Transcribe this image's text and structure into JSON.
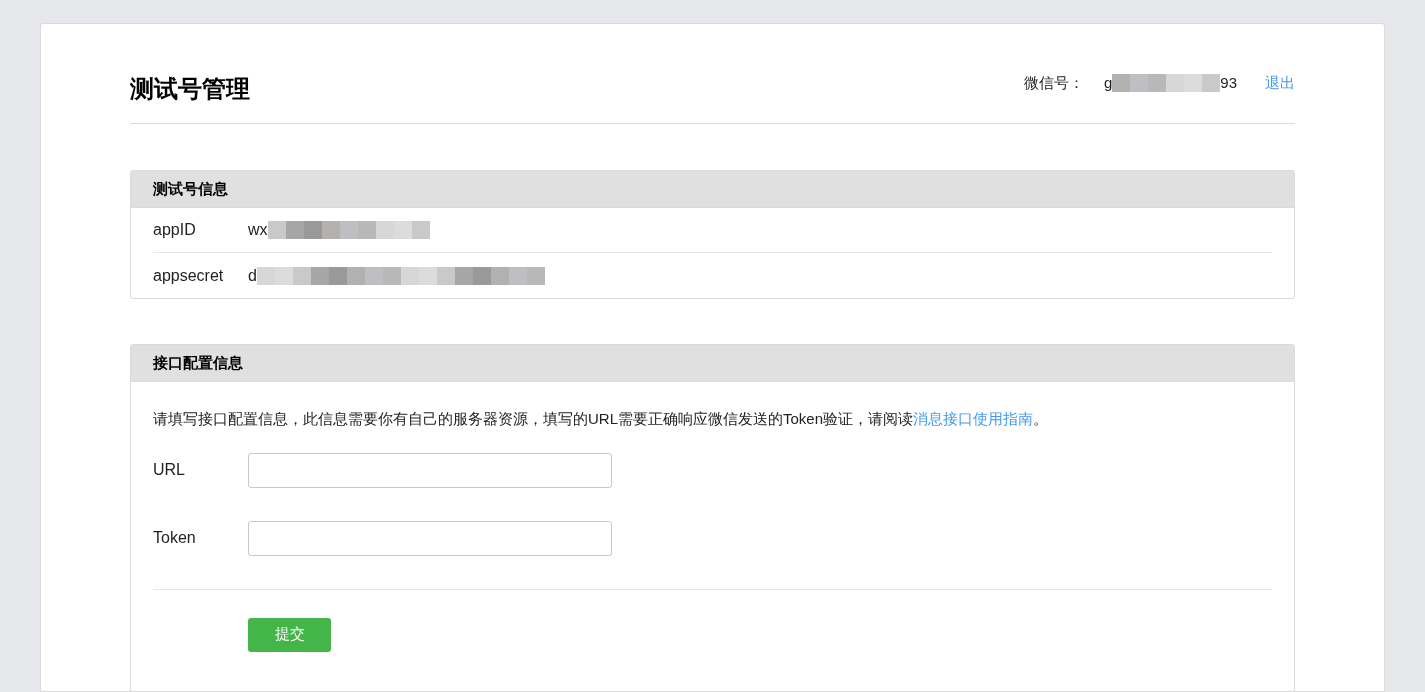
{
  "header": {
    "title": "测试号管理",
    "wechat_label": "微信号：",
    "wechat_id": {
      "start": "g",
      "end": "93",
      "redacted": true
    },
    "logout": "退出"
  },
  "test_account": {
    "title": "测试号信息",
    "rows": [
      {
        "label": "appID",
        "start": "wx",
        "redacted": true
      },
      {
        "label": "appsecret",
        "start": "d",
        "redacted": true
      }
    ]
  },
  "interface_config": {
    "title": "接口配置信息",
    "description": "请填写接口配置信息，此信息需要你有自己的服务器资源，填写的URL需要正确响应微信发送的Token验证，请阅读",
    "link": "消息接口使用指南",
    "period": "。",
    "fields": [
      {
        "label": "URL"
      },
      {
        "label": "Token"
      }
    ],
    "submit": "提交"
  }
}
